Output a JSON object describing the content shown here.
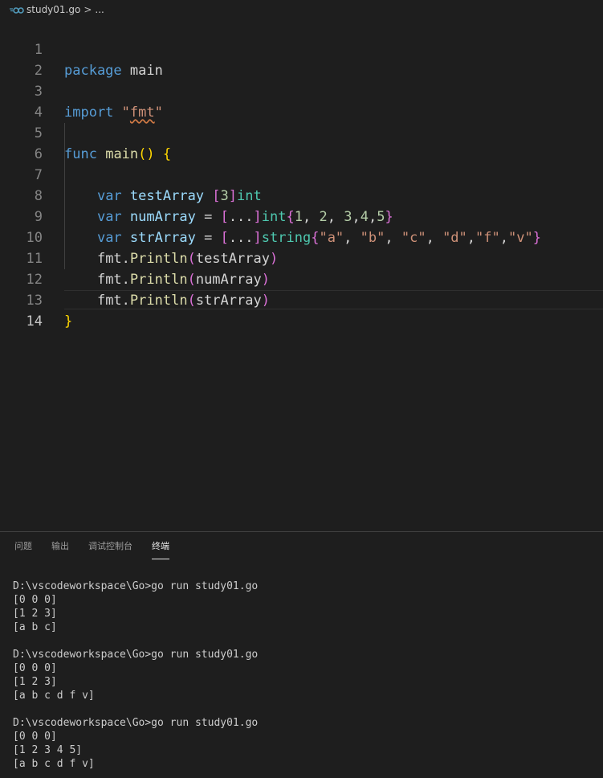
{
  "breadcrumb": {
    "file": "study01.go",
    "separator": ">",
    "more": "..."
  },
  "editor": {
    "line_numbers": [
      "1",
      "2",
      "3",
      "4",
      "5",
      "6",
      "7",
      "8",
      "9",
      "10",
      "11",
      "12",
      "13",
      "14"
    ],
    "active_line": "14"
  },
  "code": {
    "l1": {
      "kw": "package",
      "name": "main"
    },
    "l3": {
      "kw": "import",
      "str": "\"fmt\"",
      "quote_open": "\"",
      "str_inner": "fmt",
      "quote_close": "\""
    },
    "l5": {
      "kw": "func",
      "name": "main",
      "paren_open": "(",
      "paren_close": ")",
      "brace_open": "{"
    },
    "l7": {
      "kw": "var",
      "name": "testArray",
      "open": "[",
      "size": "3",
      "close": "]",
      "type": "int"
    },
    "l8": {
      "kw": "var",
      "name": "numArray",
      "eq": "=",
      "open": "[",
      "dots": "...",
      "close": "]",
      "type": "int",
      "brace_open": "{",
      "v1": "1",
      "v2": "2",
      "v3": "3",
      "v4": "4",
      "v5": "5",
      "brace_close": "}"
    },
    "l9": {
      "kw": "var",
      "name": "strArray",
      "eq": "=",
      "open": "[",
      "dots": "...",
      "close": "]",
      "type": "string",
      "brace_open": "{",
      "s1": "\"a\"",
      "s2": "\"b\"",
      "s3": "\"c\"",
      "s4": "\"d\"",
      "s5": "\"f\"",
      "s6": "\"v\"",
      "brace_close": "}"
    },
    "l10": {
      "pkg": "fmt",
      "fn": "Println",
      "open": "(",
      "arg": "testArray",
      "close": ")"
    },
    "l11": {
      "pkg": "fmt",
      "fn": "Println",
      "open": "(",
      "arg": "numArray",
      "close": ")"
    },
    "l12": {
      "pkg": "fmt",
      "fn": "Println",
      "open": "(",
      "arg": "strArray",
      "close": ")"
    },
    "l13": {
      "brace_close": "}"
    }
  },
  "panel": {
    "tabs": [
      {
        "label": "问题"
      },
      {
        "label": "输出"
      },
      {
        "label": "调试控制台"
      },
      {
        "label": "终端"
      }
    ],
    "active_tab": "终端"
  },
  "terminal": {
    "lines": [
      "D:\\vscodeworkspace\\Go>go run study01.go",
      "[0 0 0]",
      "[1 2 3]",
      "[a b c]",
      "",
      "D:\\vscodeworkspace\\Go>go run study01.go",
      "[0 0 0]",
      "[1 2 3]",
      "[a b c d f v]",
      "",
      "D:\\vscodeworkspace\\Go>go run study01.go",
      "[0 0 0]",
      "[1 2 3 4 5]",
      "[a b c d f v]"
    ]
  },
  "colors": {
    "background": "#1e1e1e",
    "keyword": "#569cd6",
    "function": "#dcdcaa",
    "string": "#ce9178",
    "number": "#b5cea8",
    "type": "#4ec9b0",
    "variable": "#9cdcfe",
    "bracket_gold": "#ffd700",
    "bracket_purple": "#da70d6",
    "bracket_blue": "#179fff",
    "go_icon": "#519aba"
  }
}
